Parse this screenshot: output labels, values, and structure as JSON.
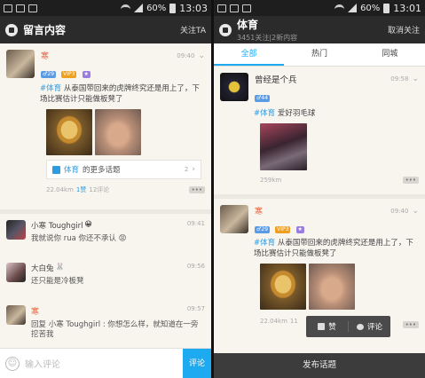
{
  "left": {
    "status": {
      "battery": "60%",
      "time": "13:03"
    },
    "title": "留言内容",
    "follow_label": "关注TA",
    "post": {
      "author": "寒",
      "badges": [
        "♂29",
        "VIP3",
        "★"
      ],
      "time": "09:40",
      "tag": "#体育",
      "text": "从泰国带回来的虎牌终究还是用上了，下场比赛估计只能做板凳了",
      "topic_label": "体育",
      "topic_more": "的更多话题",
      "topic_count": "2",
      "distance": "22.04km",
      "likes": "1赞",
      "comments": "12评论"
    },
    "comments": [
      {
        "name": "小寒 Toughgirl",
        "time": "09:41",
        "text": "我就说你 rua 你还不承认"
      },
      {
        "name": "大白兔",
        "time": "09:56",
        "text": "还只能是冷板凳"
      },
      {
        "name": "寒",
        "time": "09:57",
        "text": "回复 小寒 Toughgirl : 你想怎么样，就知道在一旁挖苦我"
      }
    ],
    "input_placeholder": "输入评论",
    "send_label": "评论"
  },
  "right": {
    "status": {
      "battery": "60%",
      "time": "13:01"
    },
    "title": "体育",
    "subtitle": "3451关注|2新内容",
    "unfollow_label": "取消关注",
    "tabs": [
      "全部",
      "热门",
      "同城"
    ],
    "post1": {
      "author": "曾经是个兵",
      "badges": [
        "♂44"
      ],
      "time": "09:58",
      "tag": "#体育",
      "text": "爱好羽毛球",
      "distance": "259km"
    },
    "post2": {
      "author": "寒",
      "badges": [
        "♂29",
        "VIP3",
        "★"
      ],
      "time": "09:40",
      "tag": "#体育",
      "text": "从泰国带回来的虎牌终究还是用上了，下场比赛估计只能做板凳了",
      "distance": "22.04km",
      "partial": "11"
    },
    "popup": {
      "like": "赞",
      "comment": "评论"
    },
    "publish_label": "发布话题"
  }
}
